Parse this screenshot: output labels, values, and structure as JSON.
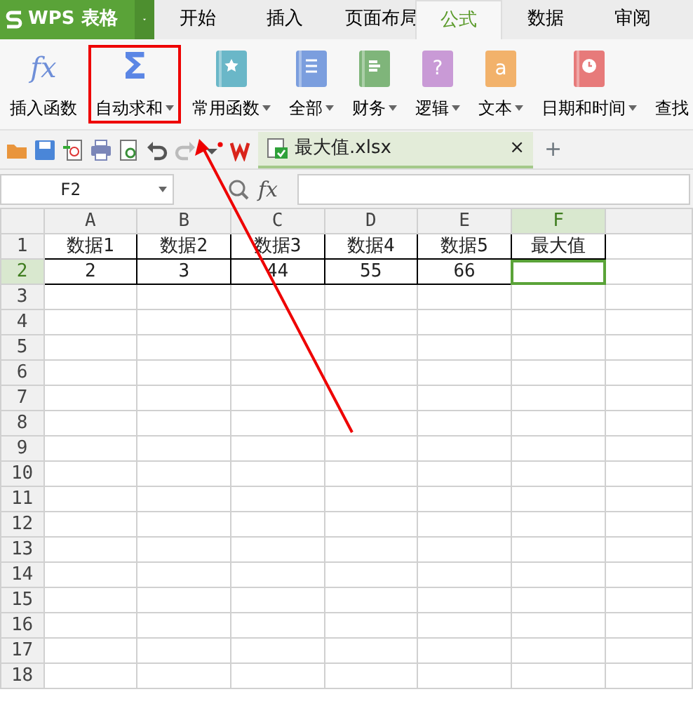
{
  "app_button": {
    "label": "WPS 表格"
  },
  "tabs": [
    {
      "label": "开始",
      "selected": false
    },
    {
      "label": "插入",
      "selected": false
    },
    {
      "label": "页面布局",
      "selected": false
    },
    {
      "label": "公式",
      "selected": true
    },
    {
      "label": "数据",
      "selected": false
    },
    {
      "label": "审阅",
      "selected": false
    }
  ],
  "ribbon": [
    {
      "label": "插入函数",
      "kind": "glyph",
      "glyph": "fx",
      "dropdown": false,
      "highlighted": false
    },
    {
      "label": "自动求和",
      "kind": "glyph",
      "glyph": "Σ",
      "dropdown": true,
      "highlighted": true
    },
    {
      "label": "常用函数",
      "kind": "star-book",
      "color": "#6ab7c8",
      "dropdown": true,
      "highlighted": false
    },
    {
      "label": "全部",
      "kind": "list-book",
      "color": "#7b9ede",
      "dropdown": true,
      "highlighted": false
    },
    {
      "label": "财务",
      "kind": "chart-book",
      "color": "#7fb57a",
      "dropdown": true,
      "highlighted": false
    },
    {
      "label": "逻辑",
      "kind": "glyph-book",
      "glyph": "?",
      "color": "#c99ad6",
      "dropdown": true,
      "highlighted": false
    },
    {
      "label": "文本",
      "kind": "glyph-book",
      "glyph": "a",
      "color": "#f2b26b",
      "dropdown": true,
      "highlighted": false
    },
    {
      "label": "日期和时间",
      "kind": "clock-book",
      "color": "#e77a7a",
      "dropdown": true,
      "highlighted": false
    },
    {
      "label": "查找",
      "kind": "cut",
      "dropdown": false,
      "highlighted": false
    }
  ],
  "file_tab": {
    "name": "最大值.xlsx",
    "close": "×",
    "new_tab": "+"
  },
  "formula_bar": {
    "name_box": "F2",
    "fx": "fx"
  },
  "sheet": {
    "columns": [
      {
        "label": "A",
        "selected": false
      },
      {
        "label": "B",
        "selected": false
      },
      {
        "label": "C",
        "selected": false
      },
      {
        "label": "D",
        "selected": false
      },
      {
        "label": "E",
        "selected": false
      },
      {
        "label": "F",
        "selected": true
      }
    ],
    "rows": [
      {
        "label": "1",
        "selected": false,
        "cells": [
          {
            "text": "数据1",
            "selected": false
          },
          {
            "text": "数据2",
            "selected": false
          },
          {
            "text": "数据3",
            "selected": false
          },
          {
            "text": "数据4",
            "selected": false
          },
          {
            "text": "数据5",
            "selected": false
          },
          {
            "text": "最大值",
            "selected": false
          }
        ]
      },
      {
        "label": "2",
        "selected": true,
        "cells": [
          {
            "text": "2",
            "selected": false
          },
          {
            "text": "3",
            "selected": false
          },
          {
            "text": "44",
            "selected": false
          },
          {
            "text": "55",
            "selected": false
          },
          {
            "text": "66",
            "selected": false
          },
          {
            "selected": true
          }
        ]
      },
      {
        "label": "3",
        "selected": false
      },
      {
        "label": "4",
        "selected": false
      },
      {
        "label": "5",
        "selected": false
      },
      {
        "label": "6",
        "selected": false
      },
      {
        "label": "7",
        "selected": false
      },
      {
        "label": "8",
        "selected": false
      },
      {
        "label": "9",
        "selected": false
      },
      {
        "label": "10",
        "selected": false
      },
      {
        "label": "11",
        "selected": false
      },
      {
        "label": "12",
        "selected": false
      },
      {
        "label": "13",
        "selected": false
      },
      {
        "label": "14",
        "selected": false
      },
      {
        "label": "15",
        "selected": false
      },
      {
        "label": "16",
        "selected": false
      },
      {
        "label": "17",
        "selected": false
      },
      {
        "label": "18",
        "selected": false
      }
    ]
  },
  "annotations": [
    {
      "kind": "arrow"
    }
  ]
}
